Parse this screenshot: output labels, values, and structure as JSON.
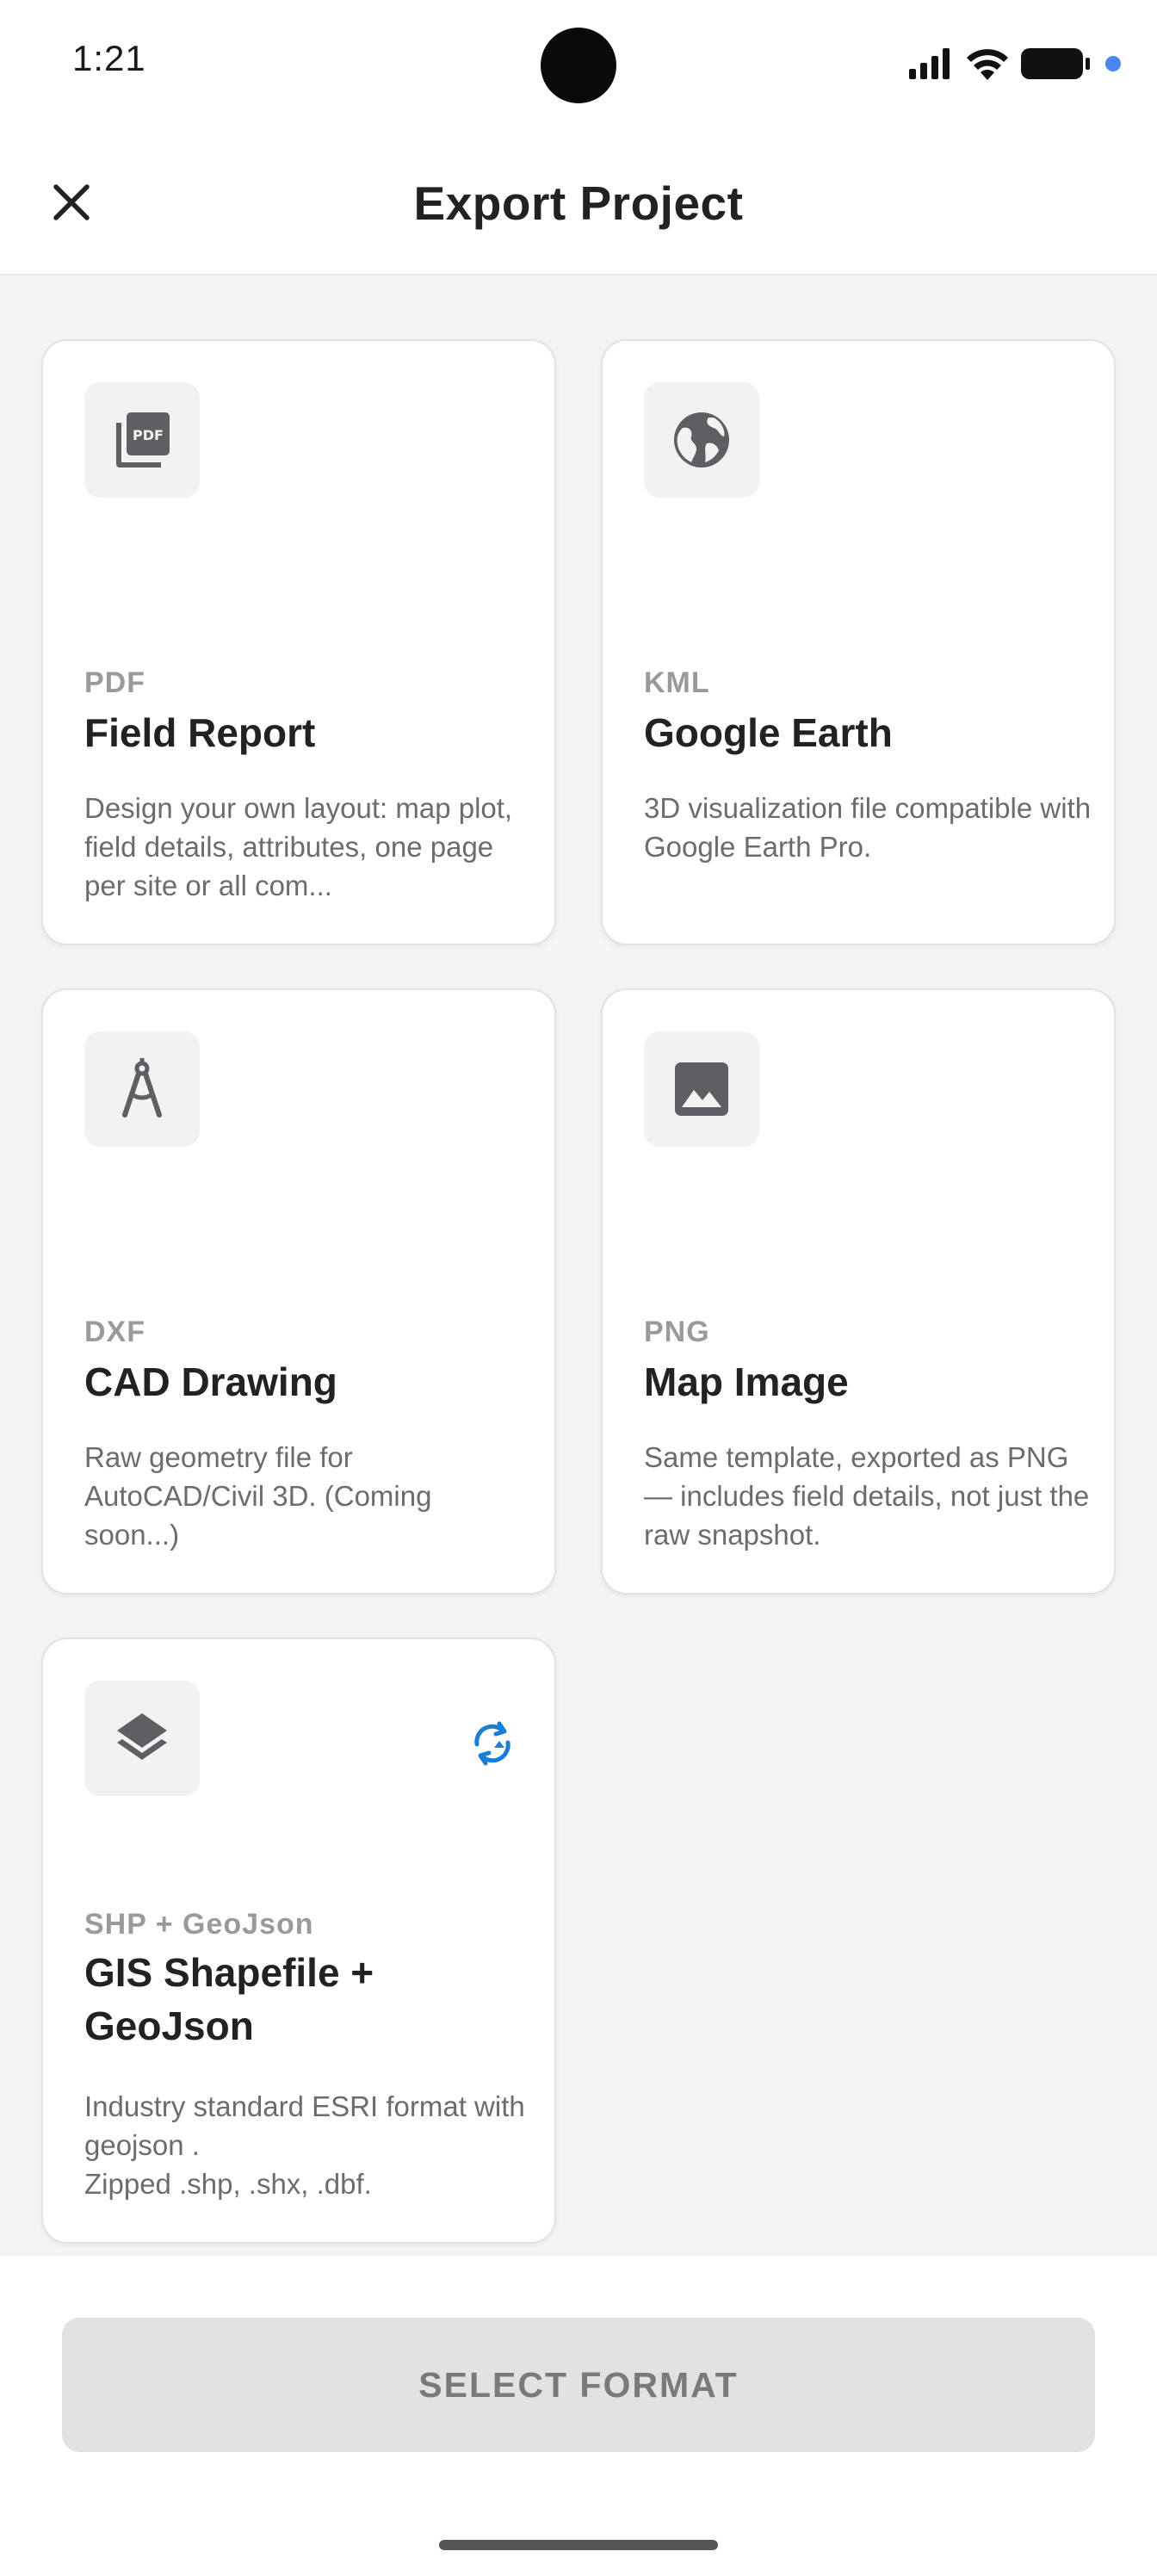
{
  "status_bar": {
    "time": "1:21",
    "icons": [
      "signal-icon",
      "wifi-icon",
      "battery-icon",
      "notification-dot-icon"
    ]
  },
  "header": {
    "title": "Export Project",
    "close_icon": "close-icon"
  },
  "cards": [
    {
      "format": "PDF",
      "title": "Field Report",
      "description": "Design your own layout: map plot, field details, attributes, one page per site or all com...",
      "icon": "pdf-icon"
    },
    {
      "format": "KML",
      "title": "Google Earth",
      "description": "3D visualization file compatible with Google Earth Pro.",
      "icon": "globe-icon"
    },
    {
      "format": "DXF",
      "title": "CAD Drawing",
      "description": "Raw geometry file for AutoCAD/Civil 3D. (Coming soon...)",
      "icon": "drafting-compass-icon"
    },
    {
      "format": "PNG",
      "title": "Map Image",
      "description": "Same template, exported as PNG — includes field details, not just the raw snapshot.",
      "icon": "image-icon"
    },
    {
      "format": "SHP + GeoJson",
      "title": "GIS Shapefile + GeoJson",
      "description": "Industry standard ESRI format with geojson .\nZipped .shp, .shx, .dbf.",
      "icon": "layers-icon",
      "badge_icon": "sync-icon"
    }
  ],
  "footer": {
    "button_label": "SELECT FORMAT"
  },
  "colors": {
    "accent": "#1a7fd4",
    "background": "#f3f4f6",
    "card": "#ffffff",
    "button_disabled": "#e2e2e2"
  }
}
